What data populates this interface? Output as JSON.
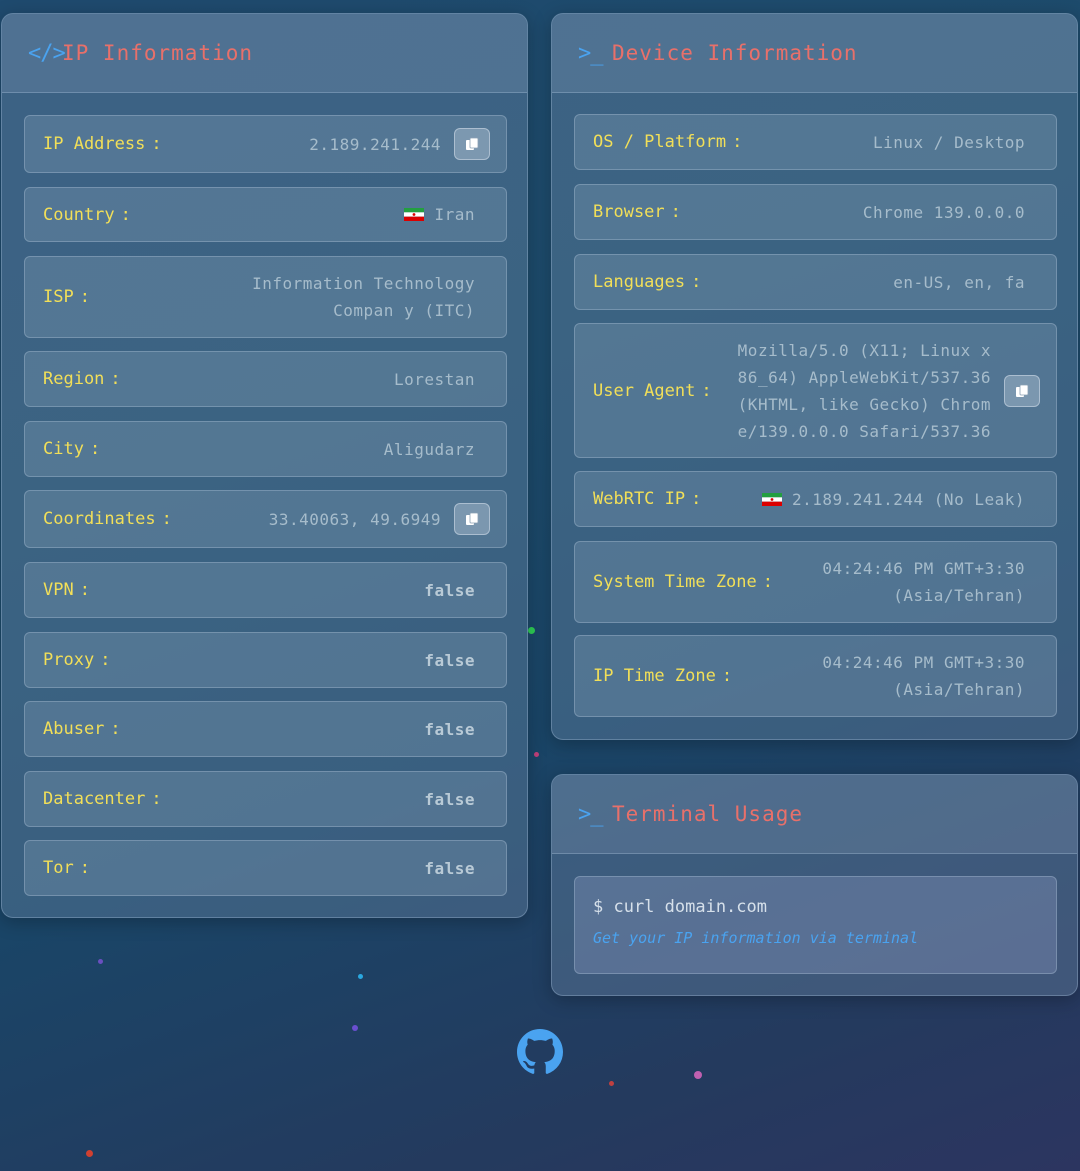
{
  "ip_card": {
    "icon": "code-icon",
    "title": "IP Information",
    "rows": [
      {
        "label": "IP Address",
        "value": "2.189.241.244",
        "copy": true
      },
      {
        "label": "Country",
        "value": "Iran",
        "flag": "iran-flag"
      },
      {
        "label": "ISP",
        "value": "Information Technology Compan y (ITC)"
      },
      {
        "label": "Region",
        "value": "Lorestan"
      },
      {
        "label": "City",
        "value": "Aligudarz"
      },
      {
        "label": "Coordinates",
        "value": "33.40063, 49.6949",
        "copy": true
      },
      {
        "label": "VPN",
        "value": "false"
      },
      {
        "label": "Proxy",
        "value": "false"
      },
      {
        "label": "Abuser",
        "value": "false"
      },
      {
        "label": "Datacenter",
        "value": "false"
      },
      {
        "label": "Tor",
        "value": "false"
      }
    ]
  },
  "device_card": {
    "icon": "terminal-icon",
    "title": "Device Information",
    "rows": [
      {
        "label": "OS / Platform",
        "value": "Linux / Desktop"
      },
      {
        "label": "Browser",
        "value": "Chrome 139.0.0.0"
      },
      {
        "label": "Languages",
        "value": "en-US, en, fa"
      },
      {
        "label": "User Agent",
        "value": "Mozilla/5.0 (X11; Linux x86_64) AppleWebKit/537.36 (KHTML, like Gecko) Chrome/139.0.0.0 Safari/537.36",
        "copy": true
      },
      {
        "label": "WebRTC IP",
        "value": "2.189.241.244 (No Leak)",
        "flag": "iran-flag"
      },
      {
        "label": "System Time Zone",
        "value": "04:24:46 PM GMT+3:30 (Asia/Tehran)"
      },
      {
        "label": "IP Time Zone",
        "value": "04:24:46 PM GMT+3:30 (Asia/Tehran)"
      }
    ]
  },
  "terminal_card": {
    "icon": "terminal-icon",
    "title": "Terminal Usage",
    "command": "$ curl domain.com",
    "description": "Get your IP information via terminal"
  },
  "footer": {
    "icon": "github-icon"
  },
  "colors": {
    "accent_title": "#e8706a",
    "accent_icon": "#4aa3f0",
    "label": "#f2df58",
    "value": "#a6bccb"
  }
}
